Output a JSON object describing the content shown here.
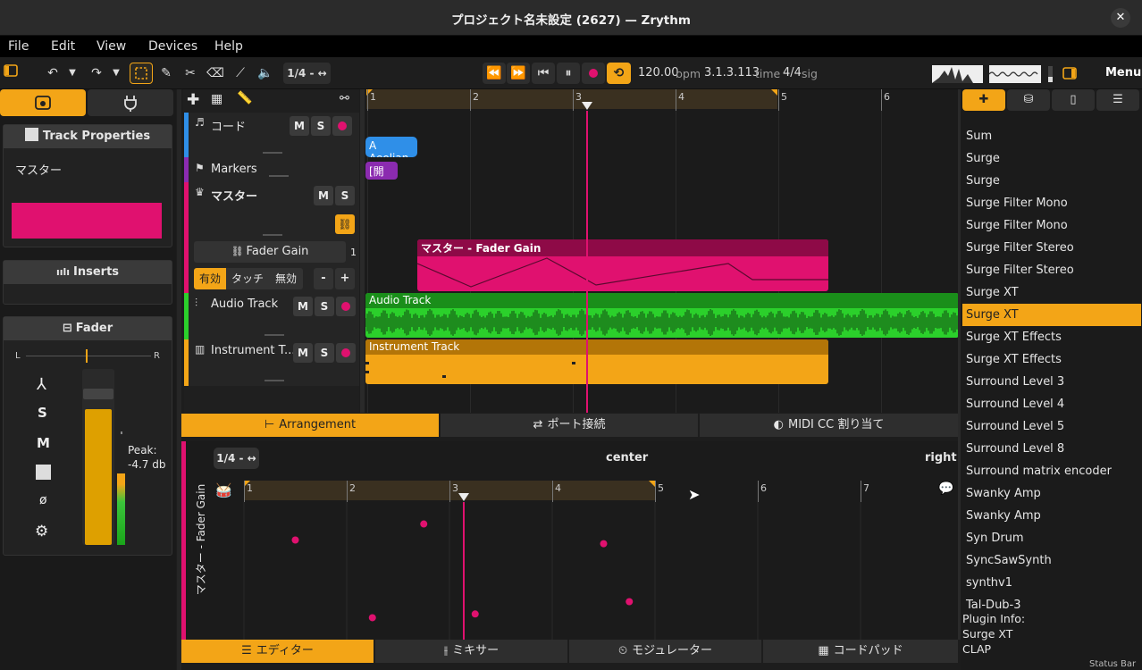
{
  "window": {
    "title": "プロジェクト名未設定 (2627) — Zrythm"
  },
  "menubar": {
    "file": "File",
    "edit": "Edit",
    "view": "View",
    "devices": "Devices",
    "help": "Help"
  },
  "toolbar": {
    "snap_label": "1/4 - ↔",
    "bpm_value": "120.00",
    "bpm_unit": "bpm",
    "time_value": "3.1.3.113",
    "time_unit": "time",
    "sig_value": "4/4",
    "sig_unit": "sig",
    "menu_label": "Menu"
  },
  "left_panel": {
    "track_properties_title": "Track Properties",
    "track_name": "マスター",
    "track_color": "#e0116f",
    "inserts_title": "Inserts",
    "fader_title": "Fader",
    "pan_left": "L",
    "pan_right": "R",
    "solo_label": "S",
    "mute_label": "M",
    "phase_label": "ø",
    "peak_label": "Peak:",
    "peak_value": "-4.7 db",
    "fader_level": 0.93
  },
  "tracklist": {
    "tracks": [
      {
        "name": "コード",
        "color": "#2f8fe8",
        "mute": "M",
        "solo": "S"
      },
      {
        "name": "Markers",
        "color": "#8b2bb0"
      },
      {
        "name": "マスター",
        "color": "#e0116f",
        "mute": "M",
        "solo": "S"
      },
      {
        "name": "Audio Track",
        "color": "#2bd02b",
        "mute": "M",
        "solo": "S"
      },
      {
        "name": "Instrument T...",
        "color": "#f3a517",
        "mute": "M",
        "solo": "S"
      }
    ],
    "automation": {
      "lane_label": "Fader Gain",
      "lane_index": "1",
      "mode_on": "有効",
      "mode_touch": "タッチ",
      "mode_off": "無効",
      "minus": "-",
      "plus": "+"
    }
  },
  "arranger": {
    "ruler_numbers": [
      "1",
      "2",
      "3",
      "4",
      "5",
      "6"
    ],
    "chord_region": "A Aeolian",
    "marker_region": "[開始]",
    "automation_region": "マスター - Fader Gain",
    "audio_region": "Audio Track",
    "instrument_region": "Instrument Track",
    "playhead_position_bar": 3.1
  },
  "center_tabs": {
    "arrangement": "Arrangement",
    "port_connections": "ポート接続",
    "midi_cc": "MIDI CC 割り当て"
  },
  "editor": {
    "snap_label": "1/4 - ↔",
    "center_label": "center",
    "right_label": "right",
    "vertical_label": "マスター - Fader Gain",
    "ruler_numbers": [
      "1",
      "2",
      "3",
      "4",
      "5",
      "6",
      "7"
    ]
  },
  "bottom_tabs": {
    "editor": "エディター",
    "mixer": "ミキサー",
    "modulator": "モジュレーター",
    "chord_pad": "コードパッド"
  },
  "plugin_browser": {
    "items": [
      "Sum",
      "Surge",
      "Surge",
      "Surge Filter Mono",
      "Surge Filter Mono",
      "Surge Filter Stereo",
      "Surge Filter Stereo",
      "Surge XT",
      "Surge XT",
      "Surge XT Effects",
      "Surge XT Effects",
      "Surround Level 3",
      "Surround Level 4",
      "Surround Level 5",
      "Surround Level 8",
      "Surround matrix encoder",
      "Swanky Amp",
      "Swanky Amp",
      "Syn Drum",
      "SyncSawSynth",
      "synthv1",
      "Tal-Dub-3"
    ],
    "selected_index": 8,
    "info_title": "Plugin Info:",
    "info_name": "Surge XT",
    "info_format": "CLAP"
  },
  "status_bar": {
    "text": "Status Bar"
  },
  "colors": {
    "accent": "#f3a517",
    "master": "#e0116f",
    "audio": "#2bd02b",
    "chord": "#2f8fe8",
    "marker": "#8b2bb0"
  },
  "chart_data": {
    "type": "scatter",
    "title": "",
    "xlabel": "",
    "ylabel": "",
    "xlim": [
      1,
      7.6
    ],
    "ylim": [
      0,
      1
    ],
    "points": [
      {
        "x": 1.5,
        "y": 0.75
      },
      {
        "x": 2.25,
        "y": 0.12
      },
      {
        "x": 2.75,
        "y": 0.88
      },
      {
        "x": 3.25,
        "y": 0.15
      },
      {
        "x": 4.5,
        "y": 0.72
      },
      {
        "x": 4.75,
        "y": 0.25
      }
    ]
  }
}
